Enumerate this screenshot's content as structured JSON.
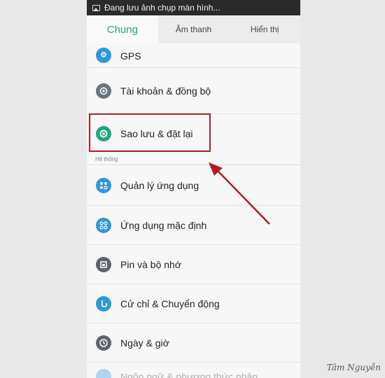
{
  "status_bar": {
    "text": "Đang lưu ảnh chụp màn hình..."
  },
  "tabs": [
    {
      "label": "Chung",
      "active": true
    },
    {
      "label": "Âm thanh",
      "active": false
    },
    {
      "label": "Hiển thị",
      "active": false
    }
  ],
  "section_header": "Hệ thống",
  "items": [
    {
      "label": "GPS",
      "icon": "location-icon",
      "color": "#2f97d8"
    },
    {
      "label": "Tài khoản & đồng bộ",
      "icon": "account-sync-icon",
      "color": "#6a7380"
    },
    {
      "label": "Sao lưu & đặt lại",
      "icon": "backup-reset-icon",
      "color": "#23a67a"
    },
    {
      "label": "Quản lý ứng dụng",
      "icon": "app-manager-icon",
      "color": "#2f97d8"
    },
    {
      "label": "Ứng dụng mặc định",
      "icon": "default-apps-icon",
      "color": "#2f97d8"
    },
    {
      "label": "Pin và bộ nhớ",
      "icon": "battery-storage-icon",
      "color": "#5a6472"
    },
    {
      "label": "Cử chỉ & Chuyển động",
      "icon": "gesture-icon",
      "color": "#2f97d8"
    },
    {
      "label": "Ngày & giờ",
      "icon": "clock-icon",
      "color": "#5a6472"
    },
    {
      "label": "Ngôn ngữ & phương thức nhập",
      "icon": "language-icon",
      "color": "#2f97d8"
    }
  ],
  "watermark": "Tâm Nguyễn",
  "annotation_color": "#b01c24"
}
